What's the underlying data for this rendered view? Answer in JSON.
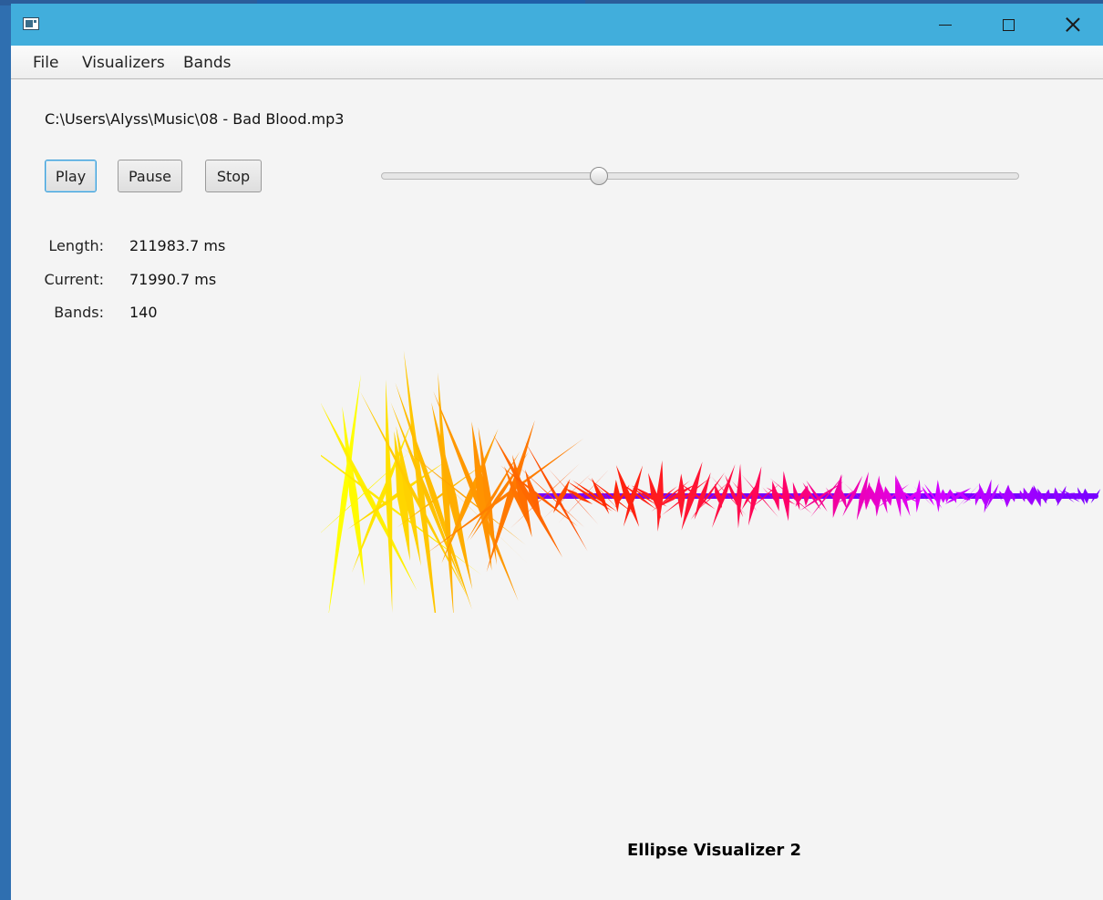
{
  "window": {
    "title": "",
    "controls": {
      "minimize_icon": "minimize-icon",
      "maximize_icon": "maximize-icon",
      "close_icon": "close-icon"
    }
  },
  "menu": {
    "items": [
      {
        "label": "File"
      },
      {
        "label": "Visualizers"
      },
      {
        "label": "Bands"
      }
    ]
  },
  "player": {
    "file_path": "C:\\Users\\Alyss\\Music\\08 - Bad Blood.mp3",
    "buttons": {
      "play": "Play",
      "pause": "Pause",
      "stop": "Stop"
    },
    "seek_progress": 0.34
  },
  "info": {
    "length_label": "Length:",
    "length_value": "211983.7 ms",
    "current_label": "Current:",
    "current_value": "71990.7 ms",
    "bands_label": "Bands:",
    "bands_value": "140"
  },
  "visualizer": {
    "name": "Ellipse Visualizer 2",
    "color_start": "#ffff00",
    "color_mid": "#ff0066",
    "color_end": "#7700ff"
  },
  "colors": {
    "titlebar": "#41aedc",
    "window_bg": "#f4f4f4"
  }
}
